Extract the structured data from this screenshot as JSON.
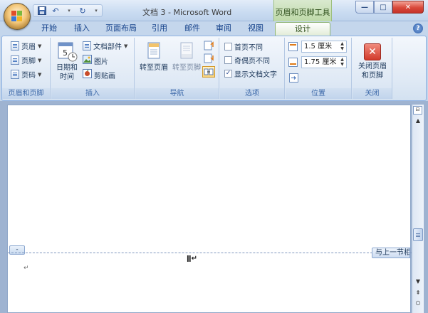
{
  "titlebar": {
    "document_title": "文档 3 - Microsoft Word",
    "context_tab_title": "页眉和页脚工具",
    "window_controls": {
      "minimize": "—",
      "maximize": "□",
      "close": "✕"
    },
    "qat_separator": "▾"
  },
  "tabs": [
    {
      "label": "开始"
    },
    {
      "label": "插入"
    },
    {
      "label": "页面布局"
    },
    {
      "label": "引用"
    },
    {
      "label": "邮件"
    },
    {
      "label": "审阅"
    },
    {
      "label": "视图"
    },
    {
      "label": "设计",
      "active": true
    }
  ],
  "help_label": "?",
  "ribbon": {
    "group_header_footer": {
      "label": "页眉和页脚",
      "items": [
        {
          "label": "页眉"
        },
        {
          "label": "页脚"
        },
        {
          "label": "页码"
        }
      ]
    },
    "group_insert": {
      "label": "插入",
      "datetime_label_line1": "日期和",
      "datetime_label_line2": "时间",
      "calendar_number": "5",
      "items": [
        {
          "label": "文档部件"
        },
        {
          "label": "图片"
        },
        {
          "label": "剪贴画"
        }
      ]
    },
    "group_navigation": {
      "label": "导航",
      "goto_header": "转至页眉",
      "goto_footer": "转至页脚"
    },
    "group_options": {
      "label": "选项",
      "options": [
        {
          "label": "首页不同",
          "checked": false
        },
        {
          "label": "奇偶页不同",
          "checked": false
        },
        {
          "label": "显示文档文字",
          "checked": true
        }
      ],
      "check_mark": "✓"
    },
    "group_position": {
      "label": "位置",
      "header_distance": "1.5 厘米",
      "footer_distance": "1.75 厘米"
    },
    "group_close": {
      "label": "关闭",
      "close_line1": "关闭页眉",
      "close_line2": "和页脚",
      "close_glyph": "✕"
    }
  },
  "document": {
    "footer_tag": "-",
    "same_as_previous": "与上一节相同",
    "paragraph_mark": "↵",
    "cursor_text": "ǁ↵"
  },
  "scrollbar": {
    "up": "▲",
    "down": "▼",
    "prev": "⇞",
    "next": "○",
    "ruler": "⊟"
  },
  "colors": {
    "accent_blue": "#15428b",
    "context_green": "#bed9a8",
    "close_red": "#d9493a"
  }
}
